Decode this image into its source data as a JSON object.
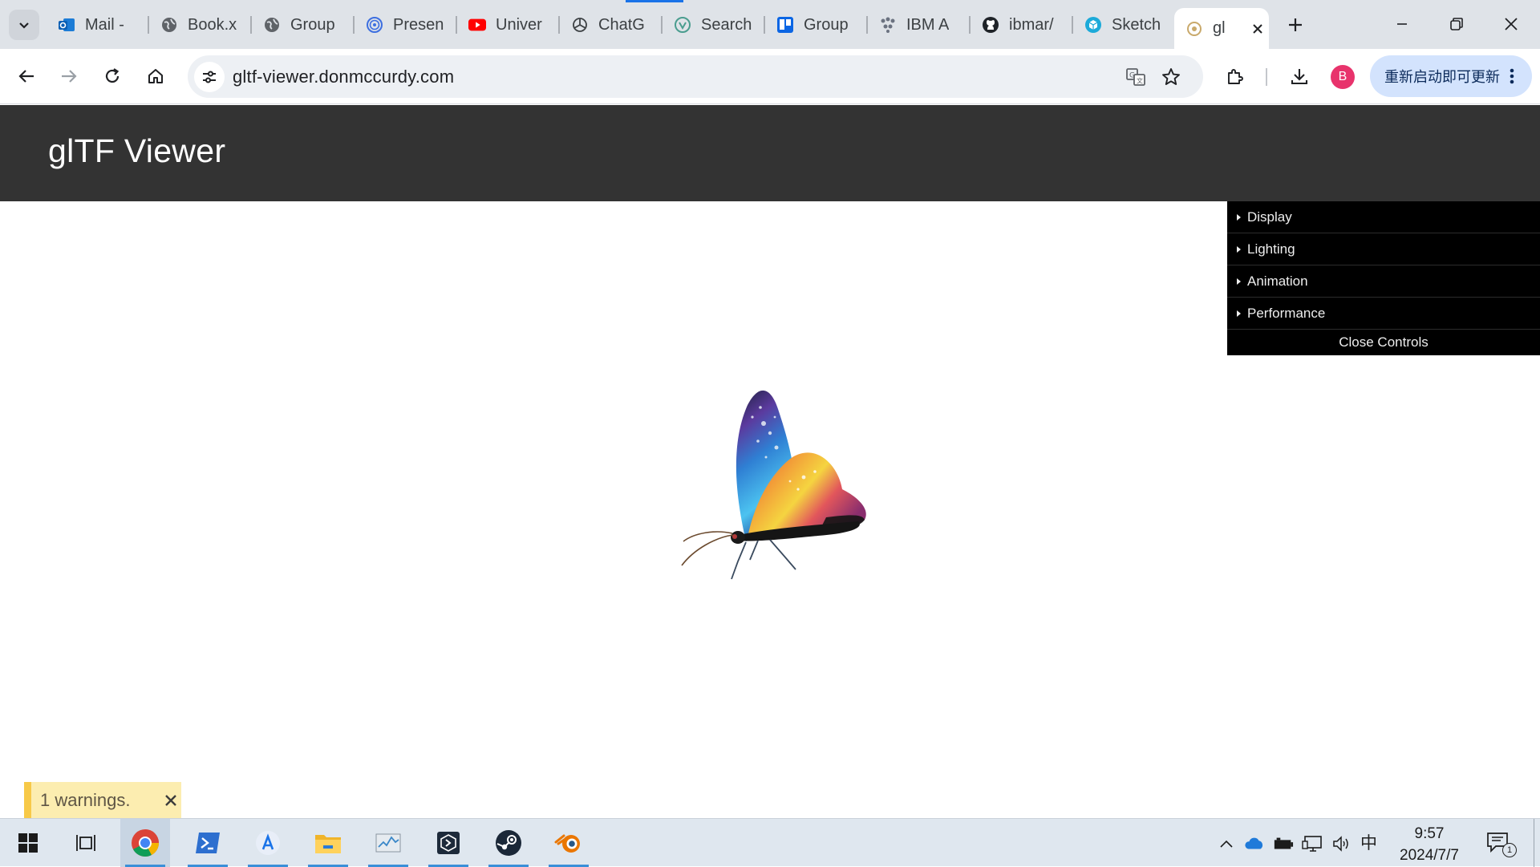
{
  "browser": {
    "tabs": [
      {
        "label": "Mail -",
        "icon": "outlook-icon"
      },
      {
        "label": "Book.x",
        "icon": "globe-icon"
      },
      {
        "label": "Group",
        "icon": "globe-icon"
      },
      {
        "label": "Presen",
        "icon": "presentation-icon"
      },
      {
        "label": "Univer",
        "icon": "youtube-icon"
      },
      {
        "label": "ChatG",
        "icon": "chatgpt-icon"
      },
      {
        "label": "Search",
        "icon": "search-engine-icon"
      },
      {
        "label": "Group",
        "icon": "trello-icon"
      },
      {
        "label": "IBM A",
        "icon": "ibm-icon"
      },
      {
        "label": "ibmar/",
        "icon": "github-icon"
      },
      {
        "label": "Sketch",
        "icon": "sketchfab-icon"
      }
    ],
    "active_tab": {
      "label": "gl",
      "icon": "gltf-icon"
    },
    "url": "gltf-viewer.donmccurdy.com",
    "update_button_label": "重新启动即可更新",
    "profile_initial": "B",
    "accent_color": "#1a73e8"
  },
  "page": {
    "title": "glTF Viewer",
    "header_color": "#333333",
    "controls": {
      "folders": [
        "Display",
        "Lighting",
        "Animation",
        "Performance"
      ],
      "close_label": "Close Controls"
    },
    "model": "butterfly",
    "toast": {
      "text": "1 warnings.",
      "color": "#f7c948"
    }
  },
  "taskbar": {
    "apps": [
      {
        "name": "chrome-icon",
        "running": true,
        "active": true
      },
      {
        "name": "powershell-icon",
        "running": true
      },
      {
        "name": "app-store-icon",
        "running": true
      },
      {
        "name": "file-explorer-icon",
        "running": true
      },
      {
        "name": "task-manager-icon",
        "running": true
      },
      {
        "name": "dev-tool-icon",
        "running": true
      },
      {
        "name": "steam-icon",
        "running": true
      },
      {
        "name": "blender-icon",
        "running": true
      }
    ],
    "ime": "中",
    "time": "9:57",
    "date": "2024/7/7",
    "notification_count": "1"
  }
}
